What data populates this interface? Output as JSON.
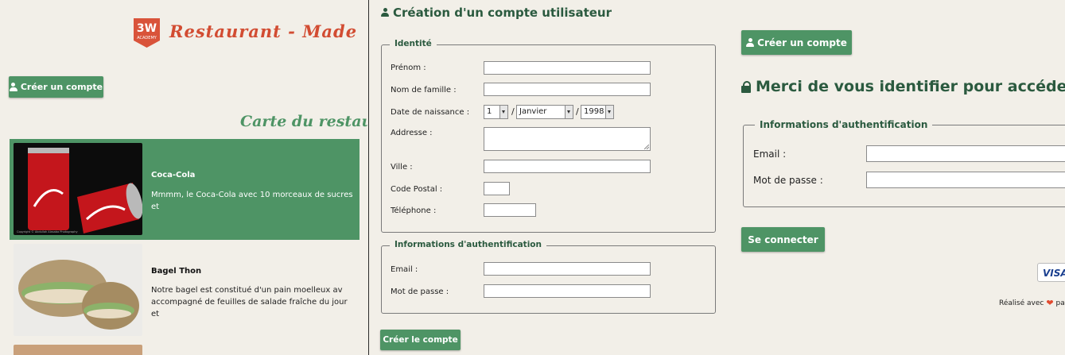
{
  "colors": {
    "accent": "#4e9465",
    "brand": "#d24c32",
    "heading": "#2b5a3f"
  },
  "restaurant_panel": {
    "logo": {
      "line1": "3W",
      "line2": "ACADEMY",
      "icon": "3w-academy-logo"
    },
    "brand_name": "Restaurant - Made",
    "create_account_label": "Créer un compte",
    "menu_title": "Carte du restaura",
    "items": [
      {
        "name": "Coca-Cola",
        "description": "Mmmm, le Coca-Cola avec 10 morceaux de sucres et",
        "image": "coca-cola-cans-photo",
        "photo_credit": "Copyright © Abdullah Alasaba Photography"
      },
      {
        "name": "Bagel Thon",
        "description": "Notre bagel est constitué d'un pain moelleux av\naccompagné de feuilles de salade fraîche du jour et",
        "image": "bagel-sandwich-photo"
      }
    ]
  },
  "signup_panel": {
    "title": "Création d'un compte utilisateur",
    "identity_legend": "Identité",
    "labels": {
      "first_name": "Prénom :",
      "last_name": "Nom de famille :",
      "birth_date": "Date de naissance :",
      "address": "Addresse :",
      "city": "Ville :",
      "postal_code": "Code Postal :",
      "phone": "Téléphone :"
    },
    "birth_day": "1",
    "birth_month": "Janvier",
    "birth_year": "1998",
    "date_separator": "/",
    "auth_legend": "Informations d'authentification",
    "email_label": "Email :",
    "password_label": "Mot de passe :",
    "submit_label": "Créer le compte"
  },
  "login_panel": {
    "create_account_label": "Créer un compte",
    "title": "Merci de vous identifier pour accéder à votr",
    "auth_legend": "Informations d'authentification",
    "email_label": "Email :",
    "password_label": "Mot de passe :",
    "login_label": "Se connecter",
    "payment_badge": "VISA",
    "credit_prefix": "Réalisé avec",
    "credit_suffix": "pa"
  }
}
